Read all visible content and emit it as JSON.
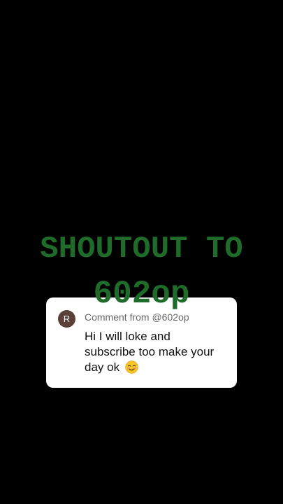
{
  "overlay": {
    "line1": "SHOUTOUT TO",
    "line2": "602op",
    "color": "#1f6b2a"
  },
  "comment": {
    "avatar_initial": "R",
    "avatar_color": "#5a4036",
    "header": "Comment from @602op",
    "text": "Hi I will loke and subscribe too make your day ok",
    "emoji": "smiling-face-emoji"
  }
}
